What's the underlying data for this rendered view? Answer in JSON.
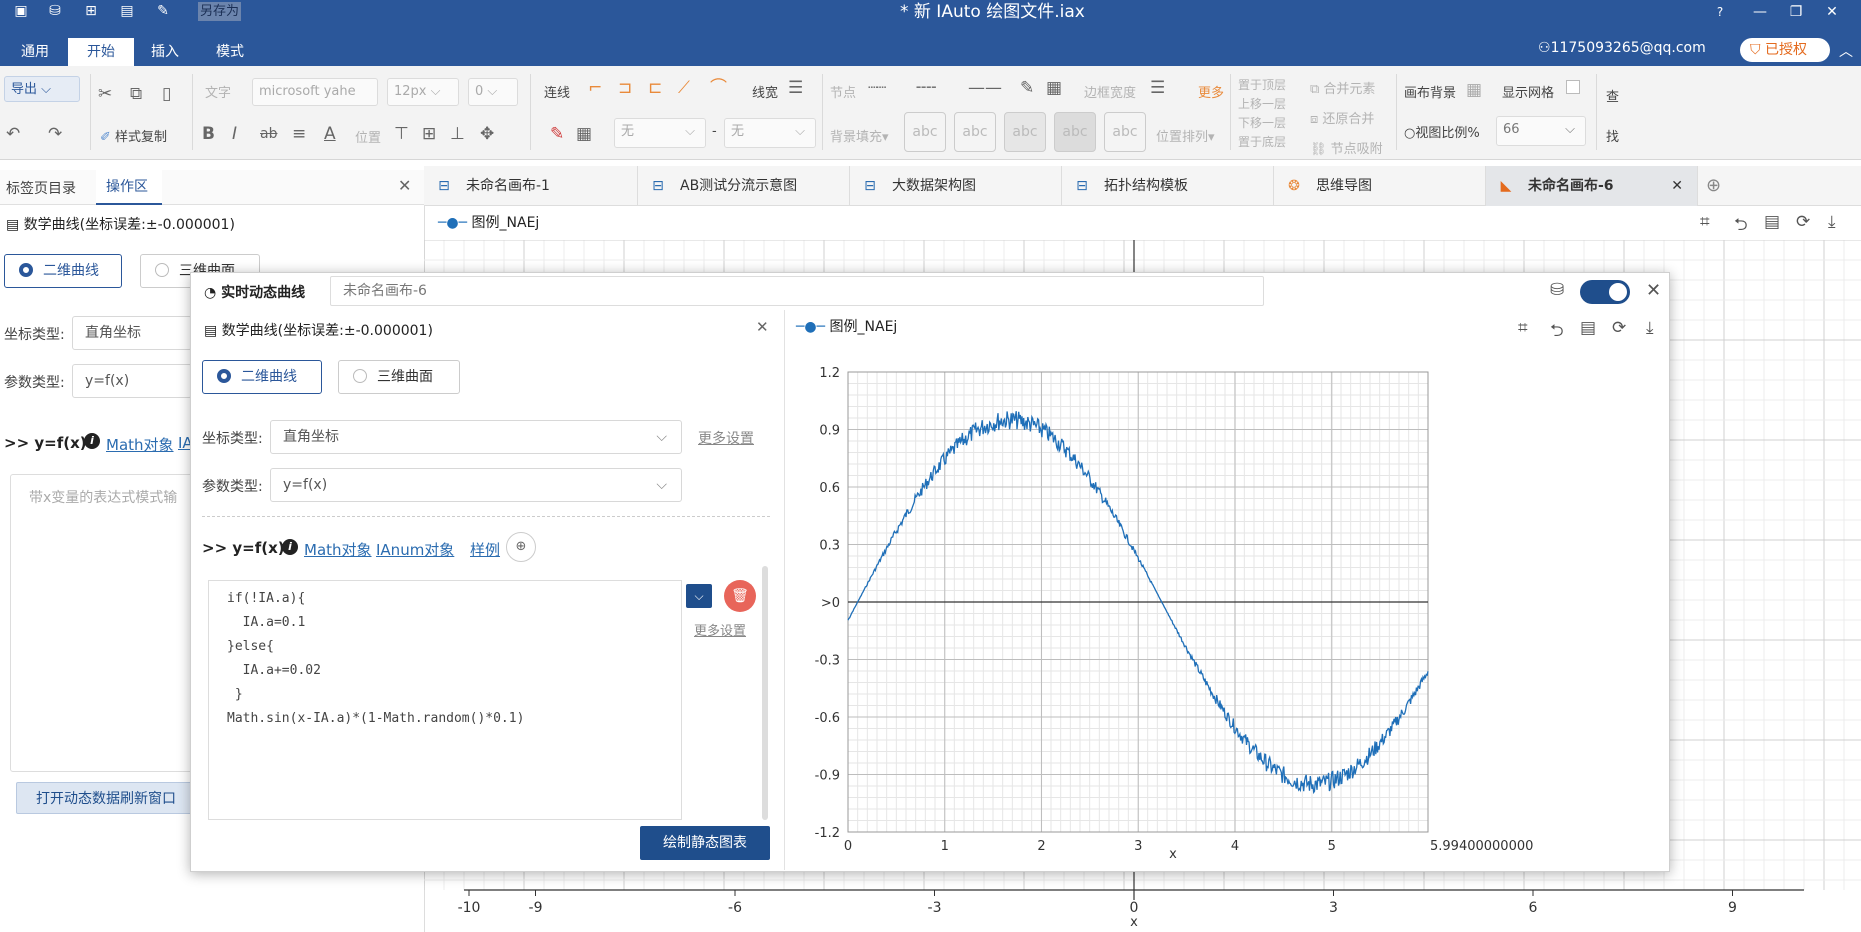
{
  "app": {
    "title": "* 新 IAuto 绘图文件.iax",
    "save_as": "另存为",
    "account": "1175093265@qq.com",
    "license": "已授权"
  },
  "menu": [
    "通用",
    "开始",
    "插入",
    "模式"
  ],
  "ribbon": {
    "export": "导出",
    "style_copy": "样式复制",
    "text": "文字",
    "font": "microsoft yahe",
    "font_size": "12px",
    "font_zero": "0",
    "position": "位置",
    "connect": "连线",
    "line_width": "线宽",
    "node": "节点",
    "border_width": "边框宽度",
    "more": "更多",
    "fill_none1": "无",
    "dash": "-",
    "fill_none2": "无",
    "bg_fill": "背景填充▾",
    "abc": "abc",
    "arrange": "位置排列▾",
    "top_layer": "置于顶层",
    "up_layer": "上移一层",
    "down_layer": "下移一层",
    "bottom_layer": "置于底层",
    "merge": "合并元素",
    "unmerge": "还原合并",
    "node_snap": "节点吸附",
    "canvas_bg": "画布背景",
    "show_grid": "显示网格",
    "view_ratio": "视图比例%",
    "ratio_value": "66",
    "find1": "查",
    "find2": "找"
  },
  "left": {
    "tab_bookmarks": "标签页目录",
    "tab_ops": "操作区",
    "curve_title": "数学曲线(坐标误差:±-0.000001)",
    "r2d": "二维曲线",
    "r3d": "三维曲面",
    "coord_label": "坐标类型:",
    "coord_value": "直角坐标",
    "param_label": "参数类型:",
    "param_value": "y=f(x)",
    "expr": ">> y=f(x)",
    "math_link": "Math对象",
    "ia_link": "IA",
    "placeholder": "带x变量的表达式模式输",
    "open_btn": "打开动态数据刷新窗口"
  },
  "doc_tabs": [
    "未命名画布-1",
    "AB测试分流示意图",
    "大数据架构图",
    "拓扑结构模板",
    "思维导图",
    "未命名画布-6"
  ],
  "canvas": {
    "legend": "图例_NAEj",
    "xaxis": [
      "-10",
      "-9",
      "-6",
      "-3",
      "0",
      "3",
      "6",
      "9"
    ],
    "xlabel": "x"
  },
  "dialog": {
    "title": "实时动态曲线",
    "canvas_name": "未命名画布-6",
    "curve_title": "数学曲线(坐标误差:±-0.000001)",
    "r2d": "二维曲线",
    "r3d": "三维曲面",
    "coord_label": "坐标类型:",
    "coord_value": "直角坐标",
    "more_settings": "更多设置",
    "param_label": "参数类型:",
    "param_value": "y=f(x)",
    "expr": ">> y=f(x)",
    "math_link": "Math对象",
    "ianum_link": "IAnum对象",
    "sample_link": "样例",
    "code": [
      "if(!IA.a){",
      "  IA.a=0.1",
      "}else{",
      "  IA.a+=0.02",
      " }",
      "Math.sin(x-IA.a)*(1-Math.random()*0.1)"
    ],
    "more_settings2": "更多设置",
    "draw_btn": "绘制静态图表",
    "legend": "图例_NAEj"
  },
  "chart_data": {
    "type": "line",
    "title": "",
    "xlabel": "x",
    "ylabel": "",
    "xlim": [
      0,
      5.994
    ],
    "ylim": [
      -1.2,
      1.2
    ],
    "x_ticks": [
      "0",
      "1",
      "2",
      "3",
      "4",
      "5",
      "5.99400000000"
    ],
    "y_ticks": [
      "1.2",
      "0.9",
      "0.6",
      "0.3",
      ">0",
      "-0.3",
      "-0.6",
      "-0.9",
      "-1.2"
    ],
    "series": [
      {
        "name": "图例_NAEj",
        "color": "#1f6fb8",
        "function": "sin(x-0.1)*(1-0.1*random)",
        "x": [
          0,
          0.5,
          1,
          1.5,
          2,
          2.5,
          3,
          3.5,
          4,
          4.5,
          5,
          5.5,
          5.99
        ],
        "y": [
          -0.1,
          0.37,
          0.78,
          0.99,
          0.93,
          0.63,
          0.17,
          -0.33,
          -0.75,
          -0.98,
          -0.95,
          -0.66,
          -0.19
        ]
      }
    ]
  }
}
